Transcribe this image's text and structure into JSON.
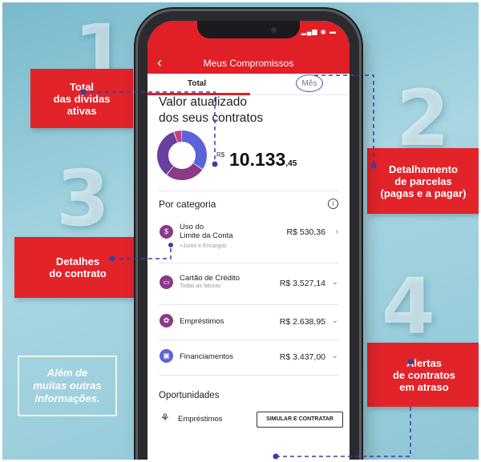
{
  "background": {
    "color": "#8fc6d6"
  },
  "accent_color": "#e01f26",
  "steps": [
    {
      "number": "1",
      "lines": [
        "Total",
        "das dívidas",
        "ativas"
      ]
    },
    {
      "number": "2",
      "lines": [
        "Detalhamento",
        "de parcelas",
        "(pagas e a pagar)"
      ]
    },
    {
      "number": "3",
      "lines": [
        "Detalhes",
        "do contrato"
      ]
    },
    {
      "number": "4",
      "lines": [
        "Alertas",
        "de contratos",
        "em atraso"
      ]
    }
  ],
  "note": {
    "lines": [
      "Além de",
      "muitas outras",
      "informações."
    ]
  },
  "app": {
    "title": "Meus Compromissos",
    "back_icon": "chevron-left-icon",
    "tabs": [
      {
        "label": "Total",
        "active": true
      },
      {
        "label": "Mês",
        "active": false
      }
    ],
    "summary": {
      "title_line1": "Valor atualizado",
      "title_line2": "dos seus contratos",
      "currency": "R$",
      "amount": "10.133",
      "cents": ",45"
    },
    "donut": {
      "segments": [
        {
          "name": "Cartão de Crédito",
          "value": 3527.14,
          "color": "#5b63d9"
        },
        {
          "name": "Empréstimos",
          "value": 2638.95,
          "color": "#8a3a86"
        },
        {
          "name": "Financiamentos",
          "value": 3437.0,
          "color": "#6a3f9e"
        },
        {
          "name": "Uso do Limite da Conta",
          "value": 530.36,
          "color": "#c2417a"
        }
      ]
    },
    "category_title": "Por categoria",
    "info_icon": "info-icon",
    "categories": [
      {
        "label_line1": "Uso do",
        "label_line2": "Limite da Conta",
        "sub": "+Juros e Encargos",
        "value": "R$ 530,36",
        "icon": "limit-icon",
        "chevron": "chevron-right-icon"
      },
      {
        "label_line1": "Cartão de Crédito",
        "label_line2": "",
        "sub": "Todas as faturas",
        "value": "R$ 3.527,14",
        "icon": "credit-card-icon",
        "chevron": "chevron-down-icon"
      },
      {
        "label_line1": "Empréstimos",
        "label_line2": "",
        "sub": "",
        "value": "R$ 2.638,95",
        "icon": "loan-icon",
        "chevron": "chevron-down-icon"
      },
      {
        "label_line1": "Financiamentos",
        "label_line2": "",
        "sub": "",
        "value": "R$ 3.437,00",
        "icon": "financing-icon",
        "chevron": "chevron-down-icon"
      }
    ],
    "opportunities": {
      "title": "Oportunidades",
      "item_label": "Empréstimos",
      "item_icon": "loan-icon",
      "button_label": "SIMULAR E CONTRATAR"
    }
  }
}
